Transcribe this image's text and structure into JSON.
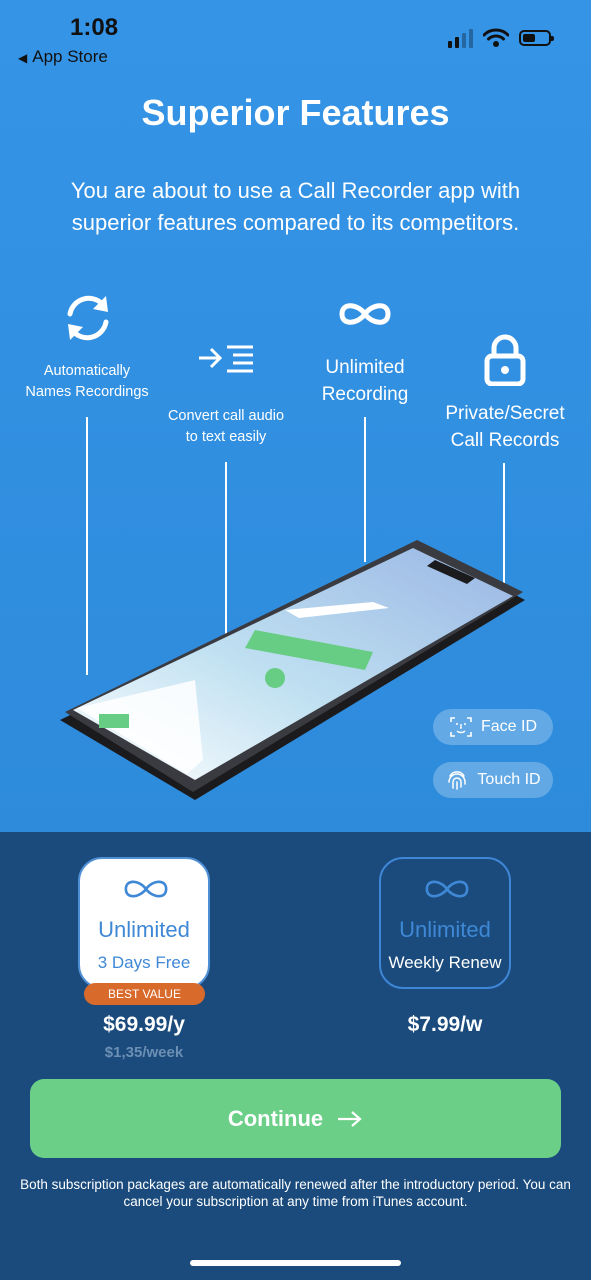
{
  "status_bar": {
    "time": "1:08",
    "back_label": "App Store"
  },
  "header": {
    "title": "Superior Features",
    "subtitle": "You are about to use a Call Recorder app with superior features compared to its competitors."
  },
  "features": [
    {
      "icon": "refresh-icon",
      "label": "Automatically Names Recordings"
    },
    {
      "icon": "text-convert-icon",
      "label": "Convert call audio to text easily"
    },
    {
      "icon": "infinity-icon",
      "label": "Unlimited Recording"
    },
    {
      "icon": "lock-icon",
      "label": "Private/Secret Call Records"
    }
  ],
  "auth_badges": {
    "face_id": "Face ID",
    "touch_id": "Touch ID"
  },
  "plans": [
    {
      "name": "Unlimited",
      "sub": "3 Days Free",
      "badge": "BEST VALUE",
      "price": "$69.99/y",
      "per_week": "$1,35/week",
      "selected": true
    },
    {
      "name": "Unlimited",
      "sub": "Weekly Renew",
      "price": "$7.99/w",
      "selected": false
    }
  ],
  "continue_label": "Continue",
  "footnote": "Both subscription packages are automatically renewed after the introductory period. You can cancel your subscription at any time from iTunes account.",
  "colors": {
    "background": "#2f8ee0",
    "bottom_panel": "#1a4b7c",
    "accent": "#3f88d6",
    "continue": "#6bcf88",
    "badge": "#d86a2c"
  }
}
